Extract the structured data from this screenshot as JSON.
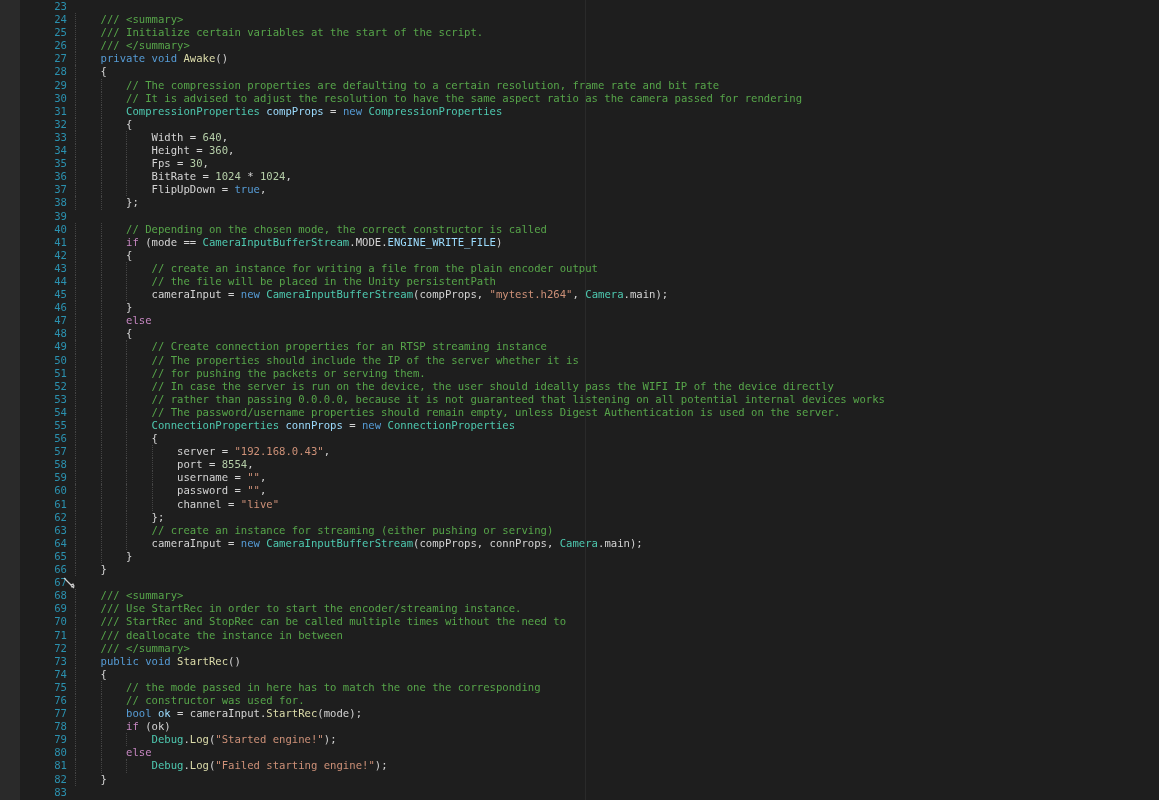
{
  "editor": {
    "lines": [
      {
        "number": "23"
      },
      {
        "number": "24",
        "tokens": [
          {
            "kind": "comment",
            "text": "    /// <summary>"
          }
        ]
      },
      {
        "number": "25",
        "tokens": [
          {
            "kind": "comment",
            "text": "    /// Initialize certain variables at the start of the script."
          }
        ]
      },
      {
        "number": "26",
        "tokens": [
          {
            "kind": "comment",
            "text": "    /// </summary>"
          }
        ]
      },
      {
        "number": "27",
        "tokens": [
          {
            "kind": "keyword",
            "text": "    private "
          },
          {
            "kind": "keyword",
            "text": "void "
          },
          {
            "kind": "function",
            "text": "Awake"
          },
          {
            "kind": "plain",
            "text": "()"
          }
        ]
      },
      {
        "number": "28",
        "tokens": [
          {
            "kind": "plain",
            "text": "    {"
          }
        ]
      },
      {
        "number": "29",
        "tokens": [
          {
            "kind": "comment",
            "text": "        // The compression properties are defaulting to a certain resolution, frame rate and bit rate"
          }
        ]
      },
      {
        "number": "30",
        "tokens": [
          {
            "kind": "comment",
            "text": "        // It is advised to adjust the resolution to have the same aspect ratio as the camera passed for rendering"
          }
        ]
      },
      {
        "number": "31",
        "tokens": [
          {
            "kind": "type",
            "text": "        CompressionProperties "
          },
          {
            "kind": "variable",
            "text": "compProps"
          },
          {
            "kind": "plain",
            "text": " = "
          },
          {
            "kind": "keyword",
            "text": "new "
          },
          {
            "kind": "type",
            "text": "CompressionProperties"
          }
        ]
      },
      {
        "number": "32",
        "tokens": [
          {
            "kind": "plain",
            "text": "        {"
          }
        ]
      },
      {
        "number": "33",
        "tokens": [
          {
            "kind": "plain",
            "text": "            Width = "
          },
          {
            "kind": "number",
            "text": "640"
          },
          {
            "kind": "plain",
            "text": ","
          }
        ]
      },
      {
        "number": "34",
        "tokens": [
          {
            "kind": "plain",
            "text": "            Height = "
          },
          {
            "kind": "number",
            "text": "360"
          },
          {
            "kind": "plain",
            "text": ","
          }
        ]
      },
      {
        "number": "35",
        "tokens": [
          {
            "kind": "plain",
            "text": "            Fps = "
          },
          {
            "kind": "number",
            "text": "30"
          },
          {
            "kind": "plain",
            "text": ","
          }
        ]
      },
      {
        "number": "36",
        "tokens": [
          {
            "kind": "plain",
            "text": "            BitRate = "
          },
          {
            "kind": "number",
            "text": "1024"
          },
          {
            "kind": "plain",
            "text": " * "
          },
          {
            "kind": "number",
            "text": "1024"
          },
          {
            "kind": "plain",
            "text": ","
          }
        ]
      },
      {
        "number": "37",
        "tokens": [
          {
            "kind": "plain",
            "text": "            FlipUpDown = "
          },
          {
            "kind": "keyword",
            "text": "true"
          },
          {
            "kind": "plain",
            "text": ","
          }
        ]
      },
      {
        "number": "38",
        "tokens": [
          {
            "kind": "plain",
            "text": "        };"
          }
        ]
      },
      {
        "number": "39"
      },
      {
        "number": "40",
        "tokens": [
          {
            "kind": "comment",
            "text": "        // Depending on the chosen mode, the correct constructor is called"
          }
        ]
      },
      {
        "number": "41",
        "tokens": [
          {
            "kind": "control",
            "text": "        if"
          },
          {
            "kind": "plain",
            "text": " (mode == "
          },
          {
            "kind": "type",
            "text": "CameraInputBufferStream"
          },
          {
            "kind": "plain",
            "text": ".MODE."
          },
          {
            "kind": "variable",
            "text": "ENGINE_WRITE_FILE"
          },
          {
            "kind": "plain",
            "text": ")"
          }
        ]
      },
      {
        "number": "42",
        "tokens": [
          {
            "kind": "plain",
            "text": "        {"
          }
        ]
      },
      {
        "number": "43",
        "tokens": [
          {
            "kind": "comment",
            "text": "            // create an instance for writing a file from the plain encoder output"
          }
        ]
      },
      {
        "number": "44",
        "tokens": [
          {
            "kind": "comment",
            "text": "            // the file will be placed in the Unity persistentPath"
          }
        ]
      },
      {
        "number": "45",
        "tokens": [
          {
            "kind": "plain",
            "text": "            cameraInput = "
          },
          {
            "kind": "keyword",
            "text": "new "
          },
          {
            "kind": "type",
            "text": "CameraInputBufferStream"
          },
          {
            "kind": "plain",
            "text": "(compProps, "
          },
          {
            "kind": "string",
            "text": "\"mytest.h264\""
          },
          {
            "kind": "plain",
            "text": ", "
          },
          {
            "kind": "type",
            "text": "Camera"
          },
          {
            "kind": "plain",
            "text": ".main);"
          }
        ]
      },
      {
        "number": "46",
        "tokens": [
          {
            "kind": "plain",
            "text": "        }"
          }
        ]
      },
      {
        "number": "47",
        "tokens": [
          {
            "kind": "control",
            "text": "        else"
          }
        ]
      },
      {
        "number": "48",
        "tokens": [
          {
            "kind": "plain",
            "text": "        {"
          }
        ]
      },
      {
        "number": "49",
        "tokens": [
          {
            "kind": "comment",
            "text": "            // Create connection properties for an RTSP streaming instance"
          }
        ]
      },
      {
        "number": "50",
        "tokens": [
          {
            "kind": "comment",
            "text": "            // The properties should include the IP of the server whether it is"
          }
        ]
      },
      {
        "number": "51",
        "tokens": [
          {
            "kind": "comment",
            "text": "            // for pushing the packets or serving them."
          }
        ]
      },
      {
        "number": "52",
        "tokens": [
          {
            "kind": "comment",
            "text": "            // In case the server is run on the device, the user should ideally pass the WIFI IP of the device directly"
          }
        ]
      },
      {
        "number": "53",
        "tokens": [
          {
            "kind": "comment",
            "text": "            // rather than passing 0.0.0.0, because it is not guaranteed that listening on all potential internal devices works"
          }
        ]
      },
      {
        "number": "54",
        "tokens": [
          {
            "kind": "comment",
            "text": "            // The password/username properties should remain empty, unless Digest Authentication is used on the server."
          }
        ]
      },
      {
        "number": "55",
        "tokens": [
          {
            "kind": "type",
            "text": "            ConnectionProperties "
          },
          {
            "kind": "variable",
            "text": "connProps"
          },
          {
            "kind": "plain",
            "text": " = "
          },
          {
            "kind": "keyword",
            "text": "new "
          },
          {
            "kind": "type",
            "text": "ConnectionProperties"
          }
        ]
      },
      {
        "number": "56",
        "tokens": [
          {
            "kind": "plain",
            "text": "            {"
          }
        ]
      },
      {
        "number": "57",
        "tokens": [
          {
            "kind": "plain",
            "text": "                server = "
          },
          {
            "kind": "string",
            "text": "\"192.168.0.43\""
          },
          {
            "kind": "plain",
            "text": ","
          }
        ]
      },
      {
        "number": "58",
        "tokens": [
          {
            "kind": "plain",
            "text": "                port = "
          },
          {
            "kind": "number",
            "text": "8554"
          },
          {
            "kind": "plain",
            "text": ","
          }
        ]
      },
      {
        "number": "59",
        "tokens": [
          {
            "kind": "plain",
            "text": "                username = "
          },
          {
            "kind": "string",
            "text": "\"\""
          },
          {
            "kind": "plain",
            "text": ","
          }
        ]
      },
      {
        "number": "60",
        "tokens": [
          {
            "kind": "plain",
            "text": "                password = "
          },
          {
            "kind": "string",
            "text": "\"\""
          },
          {
            "kind": "plain",
            "text": ","
          }
        ]
      },
      {
        "number": "61",
        "tokens": [
          {
            "kind": "plain",
            "text": "                channel = "
          },
          {
            "kind": "string",
            "text": "\"live\""
          }
        ]
      },
      {
        "number": "62",
        "tokens": [
          {
            "kind": "plain",
            "text": "            };"
          }
        ]
      },
      {
        "number": "63",
        "tokens": [
          {
            "kind": "comment",
            "text": "            // create an instance for streaming (either pushing or serving)"
          }
        ]
      },
      {
        "number": "64",
        "tokens": [
          {
            "kind": "plain",
            "text": "            cameraInput = "
          },
          {
            "kind": "keyword",
            "text": "new "
          },
          {
            "kind": "type",
            "text": "CameraInputBufferStream"
          },
          {
            "kind": "plain",
            "text": "(compProps, connProps, "
          },
          {
            "kind": "type",
            "text": "Camera"
          },
          {
            "kind": "plain",
            "text": ".main);"
          }
        ]
      },
      {
        "number": "65",
        "tokens": [
          {
            "kind": "plain",
            "text": "        }"
          }
        ]
      },
      {
        "number": "66",
        "tokens": [
          {
            "kind": "plain",
            "text": "    }"
          }
        ]
      },
      {
        "number": "67",
        "marker": true
      },
      {
        "number": "68",
        "tokens": [
          {
            "kind": "comment",
            "text": "    /// <summary>"
          }
        ]
      },
      {
        "number": "69",
        "tokens": [
          {
            "kind": "comment",
            "text": "    /// Use StartRec in order to start the encoder/streaming instance."
          }
        ]
      },
      {
        "number": "70",
        "tokens": [
          {
            "kind": "comment",
            "text": "    /// StartRec and StopRec can be called multiple times without the need to"
          }
        ]
      },
      {
        "number": "71",
        "tokens": [
          {
            "kind": "comment",
            "text": "    /// deallocate the instance in between"
          }
        ]
      },
      {
        "number": "72",
        "tokens": [
          {
            "kind": "comment",
            "text": "    /// </summary>"
          }
        ]
      },
      {
        "number": "73",
        "tokens": [
          {
            "kind": "keyword",
            "text": "    public "
          },
          {
            "kind": "keyword",
            "text": "void "
          },
          {
            "kind": "function",
            "text": "StartRec"
          },
          {
            "kind": "plain",
            "text": "()"
          }
        ]
      },
      {
        "number": "74",
        "tokens": [
          {
            "kind": "plain",
            "text": "    {"
          }
        ]
      },
      {
        "number": "75",
        "tokens": [
          {
            "kind": "comment",
            "text": "        // the mode passed in here has to match the one the corresponding"
          }
        ]
      },
      {
        "number": "76",
        "tokens": [
          {
            "kind": "comment",
            "text": "        // constructor was used for."
          }
        ]
      },
      {
        "number": "77",
        "tokens": [
          {
            "kind": "keyword",
            "text": "        bool "
          },
          {
            "kind": "variable",
            "text": "ok"
          },
          {
            "kind": "plain",
            "text": " = cameraInput."
          },
          {
            "kind": "function",
            "text": "StartRec"
          },
          {
            "kind": "plain",
            "text": "(mode);"
          }
        ]
      },
      {
        "number": "78",
        "tokens": [
          {
            "kind": "control",
            "text": "        if"
          },
          {
            "kind": "plain",
            "text": " (ok)"
          }
        ]
      },
      {
        "number": "79",
        "tokens": [
          {
            "kind": "type",
            "text": "            Debug"
          },
          {
            "kind": "plain",
            "text": "."
          },
          {
            "kind": "function",
            "text": "Log"
          },
          {
            "kind": "plain",
            "text": "("
          },
          {
            "kind": "string",
            "text": "\"Started engine!\""
          },
          {
            "kind": "plain",
            "text": ");"
          }
        ]
      },
      {
        "number": "80",
        "tokens": [
          {
            "kind": "control",
            "text": "        else"
          }
        ]
      },
      {
        "number": "81",
        "tokens": [
          {
            "kind": "type",
            "text": "            Debug"
          },
          {
            "kind": "plain",
            "text": "."
          },
          {
            "kind": "function",
            "text": "Log"
          },
          {
            "kind": "plain",
            "text": "("
          },
          {
            "kind": "string",
            "text": "\"Failed starting engine!\""
          },
          {
            "kind": "plain",
            "text": ");"
          }
        ]
      },
      {
        "number": "82",
        "tokens": [
          {
            "kind": "plain",
            "text": "    }"
          }
        ]
      },
      {
        "number": "83"
      }
    ]
  }
}
